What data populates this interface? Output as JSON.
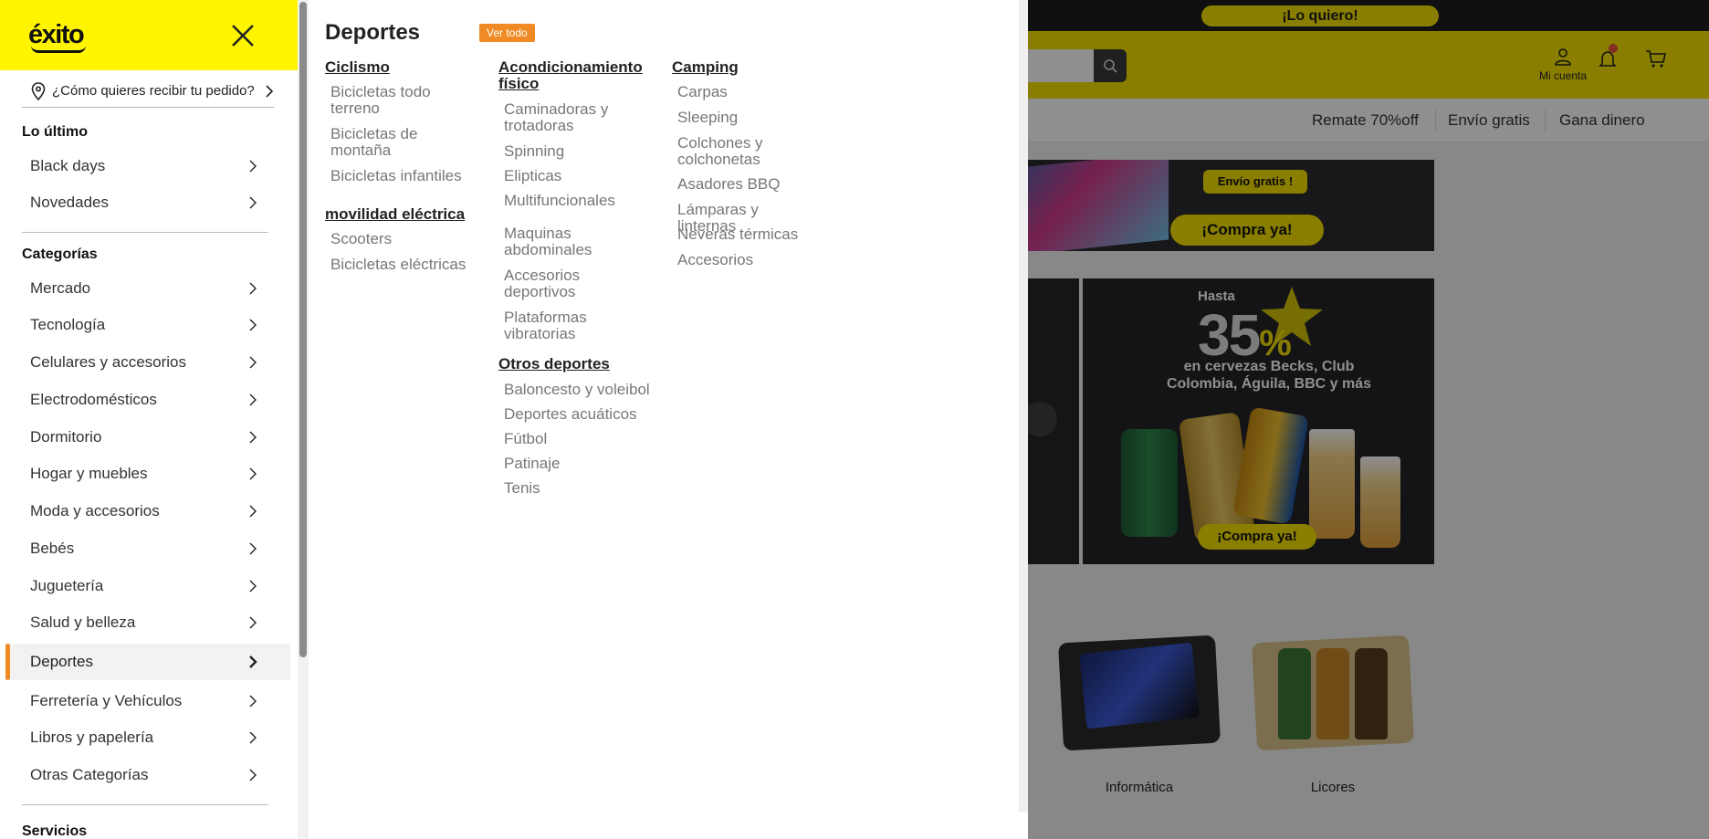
{
  "background": {
    "promo_button": "¡Lo quiero!",
    "account_label": "Mi cuenta",
    "nav_links": [
      "Remate 70%off",
      "Envío gratis",
      "Gana dinero"
    ],
    "banner1": {
      "pill": "Envío gratis !",
      "button": "¡Compra ya!"
    },
    "banner3": {
      "hasta": "Hasta",
      "number": "35",
      "percent": "%",
      "text": "en cervezas Becks, Club Colombia, Águila, BBC y más",
      "button": "¡Compra ya!"
    },
    "categories": [
      "Informática",
      "Licores"
    ],
    "colors": {
      "brand_yellow": "#fff500",
      "accent_orange": "#f08a24",
      "dark": "#1e1e1e"
    }
  },
  "sidebar": {
    "logo": "éxito",
    "delivery": "¿Cómo quieres recibir tu pedido?",
    "sections": [
      {
        "title": "Lo último",
        "items": [
          "Black days",
          "Novedades"
        ]
      },
      {
        "title": "Categorías",
        "items": [
          "Mercado",
          "Tecnología",
          "Celulares y accesorios",
          "Electrodomésticos",
          "Dormitorio",
          "Hogar y muebles",
          "Moda y accesorios",
          "Bebés",
          "Juguetería",
          "Salud y belleza",
          "Deportes",
          "Ferretería y Vehículos",
          "Libros y papelería",
          "Otras Categorías"
        ]
      },
      {
        "title": "Servicios",
        "items": []
      }
    ],
    "active_item": "Deportes"
  },
  "submenu": {
    "title": "Deportes",
    "ver_todo": "Ver todo",
    "groups": [
      {
        "title": "Ciclismo",
        "links": [
          "Bicicletas todo terreno",
          "Bicicletas de montaña",
          "Bicicletas infantiles"
        ]
      },
      {
        "title": "movilidad eléctrica",
        "links": [
          "Scooters",
          "Bicicletas eléctricas"
        ]
      },
      {
        "title": "Acondicionamiento físico",
        "links": [
          "Caminadoras y trotadoras",
          "Spinning",
          "Elipticas",
          "Multifuncionales",
          "Maquinas abdominales",
          "Accesorios deportivos",
          "Plataformas vibratorias"
        ]
      },
      {
        "title": "Otros deportes",
        "links": [
          "Baloncesto y voleibol",
          "Deportes acuáticos",
          "Fútbol",
          "Patinaje",
          "Tenis"
        ]
      },
      {
        "title": "Camping",
        "links": [
          "Carpas",
          "Sleeping",
          "Colchones y colchonetas",
          "Asadores BBQ",
          "Lámparas y linternas",
          "Neveras térmicas",
          "Accesorios"
        ]
      }
    ]
  }
}
